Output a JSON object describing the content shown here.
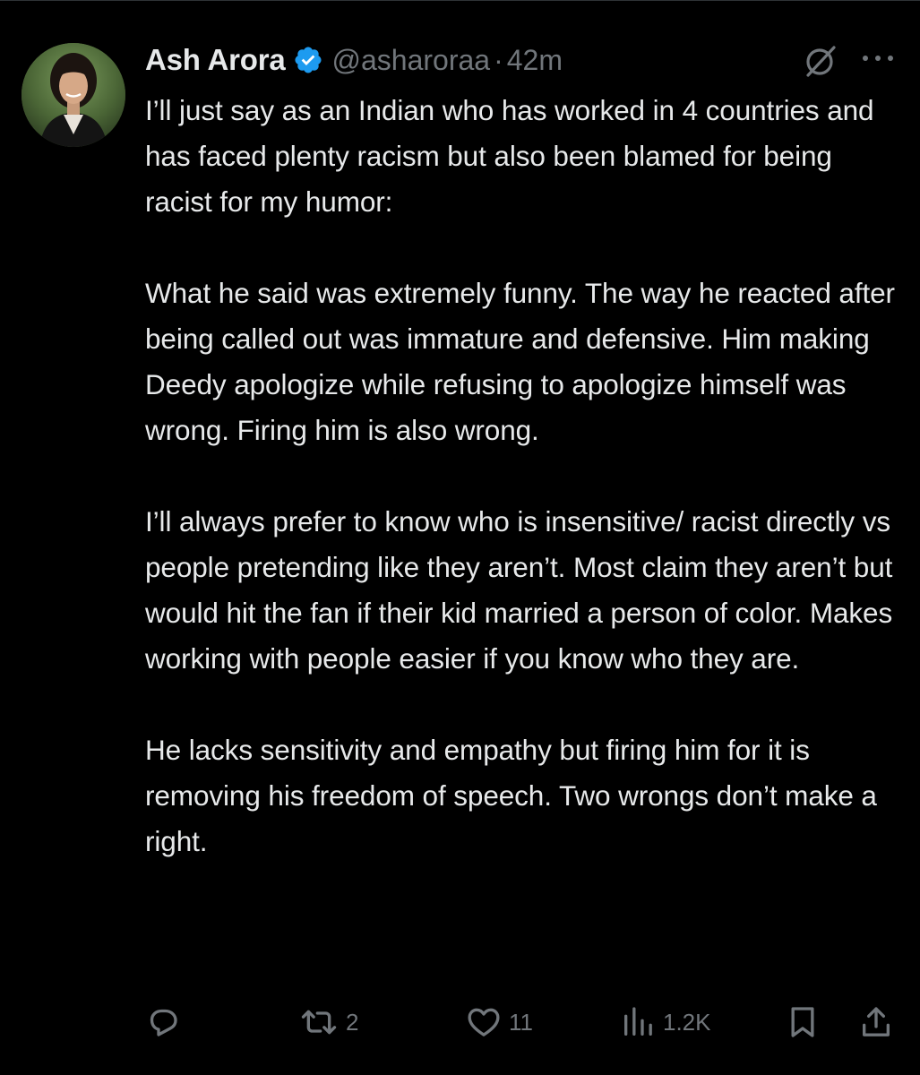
{
  "tweet": {
    "author": {
      "name": "Ash Arora",
      "handle": "@asharoraa",
      "separator": "·",
      "time": "42m"
    },
    "paragraphs": [
      "I’ll just say as an Indian who has worked in 4 countries and has faced plenty racism but also been blamed for being racist for my humor:",
      "What he said was extremely funny. The way he reacted after being called out was immature and defensive. Him making Deedy apologize while refusing to apologize himself was wrong. Firing him is also wrong.",
      "I’ll always prefer to know who is insensitive/ racist directly vs people pretending like they aren’t. Most claim they aren’t but would hit the fan if their kid married a person of color. Makes working with people easier if you know who they are.",
      "He lacks sensitivity and empathy but firing him for it is removing his freedom of speech. Two wrongs don’t make a right."
    ],
    "actions": {
      "replies": "",
      "reposts": "2",
      "likes": "11",
      "views": "1.2K"
    }
  },
  "icons": {
    "verified": "verified-badge-icon",
    "grok": "grok-icon",
    "more": "more-dots-icon",
    "reply": "reply-icon",
    "repost": "repost-icon",
    "like": "heart-icon",
    "views": "analytics-icon",
    "bookmark": "bookmark-icon",
    "share": "share-icon"
  },
  "colors": {
    "background": "#000000",
    "text": "#e7e9ea",
    "secondary": "#71767b",
    "verified": "#1d9bf0"
  }
}
